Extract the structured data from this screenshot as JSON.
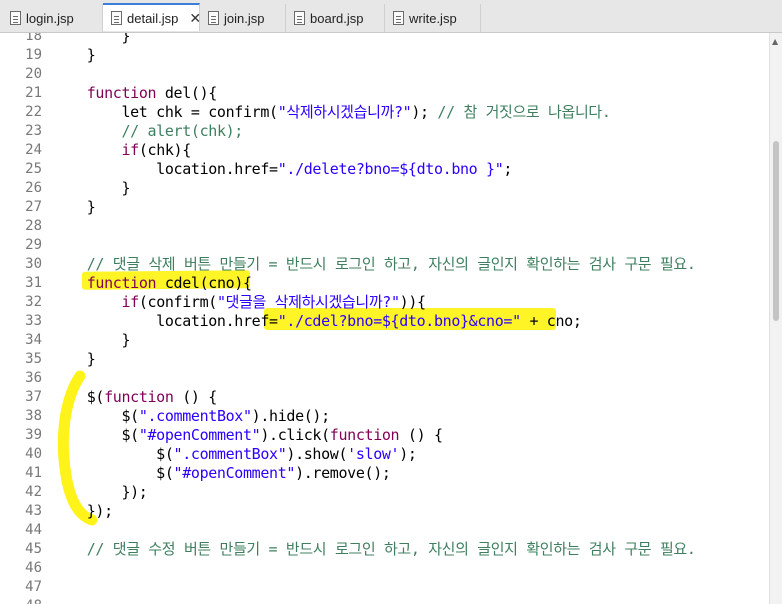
{
  "tabs": [
    {
      "label": "login.jsp",
      "active": false
    },
    {
      "label": "detail.jsp",
      "active": true
    },
    {
      "label": "join.jsp",
      "active": false
    },
    {
      "label": "board.jsp",
      "active": false
    },
    {
      "label": "write.jsp",
      "active": false
    }
  ],
  "close_glyph": "✕",
  "code": {
    "line_numbers": [
      "18",
      "19",
      "20",
      "21",
      "22",
      "23",
      "24",
      "25",
      "26",
      "27",
      "28",
      "29",
      "30",
      "31",
      "32",
      "33",
      "34",
      "35",
      "36",
      "37",
      "38",
      "39",
      "40",
      "41",
      "42",
      "43",
      "44",
      "45",
      "46",
      "47",
      "48"
    ],
    "lines": [
      [
        {
          "t": "        }",
          "c": ""
        }
      ],
      [
        {
          "t": "    }",
          "c": ""
        }
      ],
      [],
      [
        {
          "t": "    ",
          "c": ""
        },
        {
          "t": "function",
          "c": "kw"
        },
        {
          "t": " del(){",
          "c": ""
        }
      ],
      [
        {
          "t": "        let chk = confirm(",
          "c": ""
        },
        {
          "t": "\"삭제하시겠습니까?\"",
          "c": "str"
        },
        {
          "t": "); ",
          "c": ""
        },
        {
          "t": "// 참 거짓으로 나옵니다.",
          "c": "cm"
        }
      ],
      [
        {
          "t": "        ",
          "c": ""
        },
        {
          "t": "// alert(chk);",
          "c": "cm"
        }
      ],
      [
        {
          "t": "        ",
          "c": ""
        },
        {
          "t": "if",
          "c": "kw"
        },
        {
          "t": "(chk){",
          "c": ""
        }
      ],
      [
        {
          "t": "            location.href=",
          "c": ""
        },
        {
          "t": "\"./delete?bno=${dto.bno }\"",
          "c": "str"
        },
        {
          "t": ";",
          "c": ""
        }
      ],
      [
        {
          "t": "        }",
          "c": ""
        }
      ],
      [
        {
          "t": "    }",
          "c": ""
        }
      ],
      [],
      [],
      [
        {
          "t": "    ",
          "c": ""
        },
        {
          "t": "// 댓글 삭제 버튼 만들기 = 반드시 로그인 하고, 자신의 글인지 확인하는 검사 구문 필요.",
          "c": "cm"
        }
      ],
      [
        {
          "t": "    ",
          "c": ""
        },
        {
          "t": "function",
          "c": "kw"
        },
        {
          "t": " cdel(cno){",
          "c": ""
        }
      ],
      [
        {
          "t": "        ",
          "c": ""
        },
        {
          "t": "if",
          "c": "kw"
        },
        {
          "t": "(confirm(",
          "c": ""
        },
        {
          "t": "\"댓글을 삭제하시겠습니까?\"",
          "c": "str"
        },
        {
          "t": ")){",
          "c": ""
        }
      ],
      [
        {
          "t": "            location.href=",
          "c": ""
        },
        {
          "t": "\"./cdel?bno=${dto.bno}&cno=\"",
          "c": "str"
        },
        {
          "t": " + cno;",
          "c": ""
        }
      ],
      [
        {
          "t": "        }",
          "c": ""
        }
      ],
      [
        {
          "t": "    }",
          "c": ""
        }
      ],
      [],
      [
        {
          "t": "    $(",
          "c": ""
        },
        {
          "t": "function",
          "c": "kw"
        },
        {
          "t": " () {",
          "c": ""
        }
      ],
      [
        {
          "t": "        $(",
          "c": ""
        },
        {
          "t": "\".commentBox\"",
          "c": "str"
        },
        {
          "t": ").hide();",
          "c": ""
        }
      ],
      [
        {
          "t": "        $(",
          "c": ""
        },
        {
          "t": "\"#openComment\"",
          "c": "str"
        },
        {
          "t": ").click(",
          "c": ""
        },
        {
          "t": "function",
          "c": "kw"
        },
        {
          "t": " () {",
          "c": ""
        }
      ],
      [
        {
          "t": "            $(",
          "c": ""
        },
        {
          "t": "\".commentBox\"",
          "c": "str"
        },
        {
          "t": ").show(",
          "c": ""
        },
        {
          "t": "'slow'",
          "c": "str"
        },
        {
          "t": ");",
          "c": ""
        }
      ],
      [
        {
          "t": "            $(",
          "c": ""
        },
        {
          "t": "\"#openComment\"",
          "c": "str"
        },
        {
          "t": ").remove();",
          "c": ""
        }
      ],
      [
        {
          "t": "        });",
          "c": ""
        }
      ],
      [
        {
          "t": "    });",
          "c": ""
        }
      ],
      [],
      [
        {
          "t": "    ",
          "c": ""
        },
        {
          "t": "// 댓글 수정 버튼 만들기 = 반드시 로그인 하고, 자신의 글인지 확인하는 검사 구문 필요.",
          "c": "cm"
        }
      ],
      [],
      [],
      []
    ]
  },
  "colors": {
    "keyword": "#7f0055",
    "string": "#2a00ff",
    "comment": "#3f7f5f",
    "highlight": "#fff200",
    "active_tab_accent": "#3d7fd6"
  },
  "icons": {
    "file": "file-icon",
    "close": "close-icon",
    "scroll_up": "scroll-up-arrow-icon"
  }
}
